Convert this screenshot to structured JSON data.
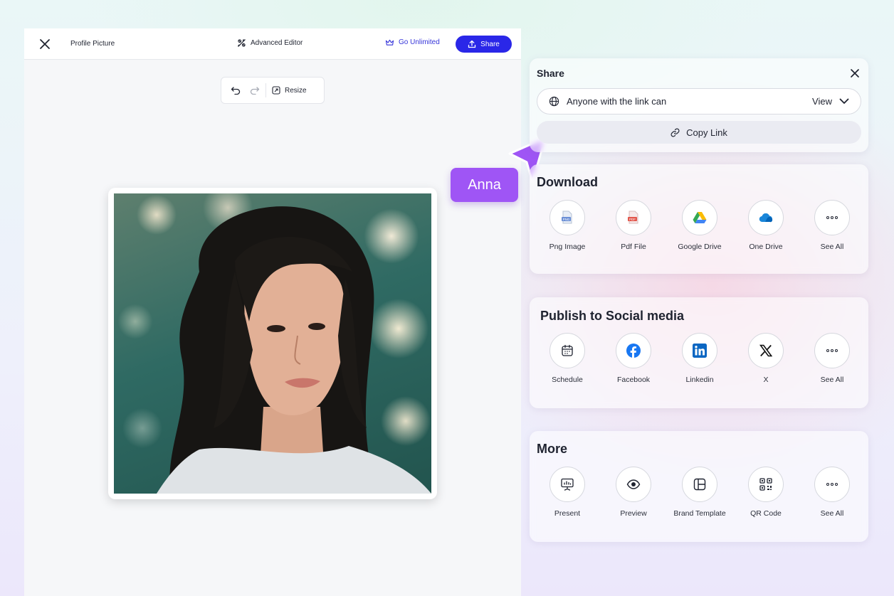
{
  "editor": {
    "title": "Profile Picture",
    "advanced_editor": "Advanced Editor",
    "go_unlimited": "Go Unlimited",
    "share_label": "Share",
    "resize_label": "Resize"
  },
  "collaborator": {
    "name": "Anna",
    "color": "#9f55f5"
  },
  "share_panel": {
    "title": "Share",
    "permission_text": "Anyone with the link can",
    "permission_value": "View",
    "copy_link": "Copy Link"
  },
  "download": {
    "title": "Download",
    "items": [
      {
        "label": "Png Image",
        "icon": "png-file-icon"
      },
      {
        "label": "Pdf File",
        "icon": "pdf-file-icon"
      },
      {
        "label": "Google Drive",
        "icon": "google-drive-icon"
      },
      {
        "label": "One Drive",
        "icon": "onedrive-icon"
      },
      {
        "label": "See All",
        "icon": "more-dots-icon"
      }
    ]
  },
  "social": {
    "title": "Publish to Social media",
    "items": [
      {
        "label": "Schedule",
        "icon": "calendar-icon"
      },
      {
        "label": "Facebook",
        "icon": "facebook-icon"
      },
      {
        "label": "Linkedin",
        "icon": "linkedin-icon"
      },
      {
        "label": "X",
        "icon": "x-icon"
      },
      {
        "label": "See All",
        "icon": "more-dots-icon"
      }
    ]
  },
  "more": {
    "title": "More",
    "items": [
      {
        "label": "Present",
        "icon": "presentation-icon"
      },
      {
        "label": "Preview",
        "icon": "eye-icon"
      },
      {
        "label": "Brand Template",
        "icon": "template-icon"
      },
      {
        "label": "QR Code",
        "icon": "qr-code-icon"
      },
      {
        "label": "See All",
        "icon": "more-dots-icon"
      }
    ]
  },
  "colors": {
    "accent": "#2a27e8",
    "cursor": "#9f55f5"
  }
}
